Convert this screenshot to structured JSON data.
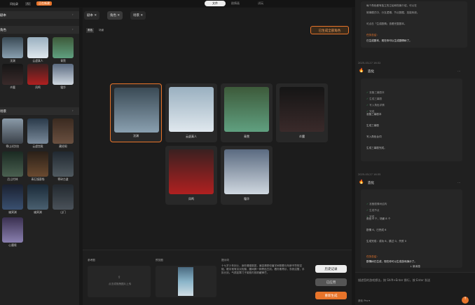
{
  "topbar": {
    "title": "问仙录",
    "badge": "AI",
    "status": "正在新建",
    "btn_active": "文件",
    "btn2": "剧情画",
    "btn3": "试玩",
    "publish": "发布"
  },
  "left": {
    "sec1": "剧本",
    "sec2": "角色",
    "sec3": "场景",
    "chars": [
      "沈渊",
      "云虚真人",
      "青霓",
      "炎魔",
      "凤鸣",
      "霜华"
    ],
    "scenes": [
      "寒山试剑台",
      "云虚宫殿",
      "藏经阁",
      "后山竹林",
      "青石镇客栈",
      "寒碎古道",
      "幽冥渊",
      "幽冥渊",
      "山门",
      "心魔境"
    ]
  },
  "tabs": [
    "剧本",
    "角色",
    "场景"
  ],
  "filters": [
    "角色",
    "场景"
  ],
  "gen_all": "已生成全部角色",
  "cards": [
    "沈渊",
    "云虚真人",
    "青霓",
    "炎魔",
    "凤鸣",
    "霜华"
  ],
  "bottom": {
    "ref_label": "参考图",
    "upload": "点击或拖拽图片上传",
    "preview_label": "预览图",
    "prompt_label": "提示词",
    "prompt": "十七岁少年剑士，身形清瘦挺拔，面容清秀但眉宇间带着与年龄不符的坚毅。眼中常有淡淡忧郁，腰间佩一柄青色古剑。着朴素青衫，衣袂洁雪，手执长剑。气质如寒门子弟般内敛却藏锋芒。",
    "btn_history": "历史记录",
    "btn_applied": "已应用",
    "btn_regen": "重新生成"
  },
  "right": {
    "top_lines": [
      "每个角色都有独立的立绘和档案介绍，可以在",
      "故事模式中，分支逻辑、节点数据、技能系统。",
      "可点击「生成剧情」查看完整剧本。"
    ],
    "task1_t": "任务总结：",
    "task1_d": "已生成剧本，现在你可以生成剧情树了。",
    "time1": "2025-03-27 16:32",
    "agent1": "造化",
    "list1": [
      "准备三幕剧本",
      "生成三幕剧",
      "写入角色详情",
      "完成"
    ],
    "lines1": [
      "准备三幕剧本",
      "生成三幕剧",
      "写入角色台词",
      "生成三幕剧完成。"
    ],
    "time2": "2025-03-27 16:35",
    "agent2": "造化",
    "list2": [
      "准备剧情树结构",
      "生成节点",
      "完成"
    ],
    "lines2": [
      "角色 6 个，场景 8 个",
      "剧情 6，已完成 6",
      "生成完成：成功 6，跳过 0，失败 0"
    ],
    "task2_t": "任务总结：",
    "task2_d": "剧情树已生成，现在你可以生成游戏演示了。",
    "new_msg": "↓ 新消息",
    "input_ph": "描述您的游戏想法，按 Shift+Enter 换行，按 Enter 发送",
    "model": "造化 Pro ▾"
  },
  "colors": {
    "accent": "#e8742a",
    "bg": "#171717"
  }
}
